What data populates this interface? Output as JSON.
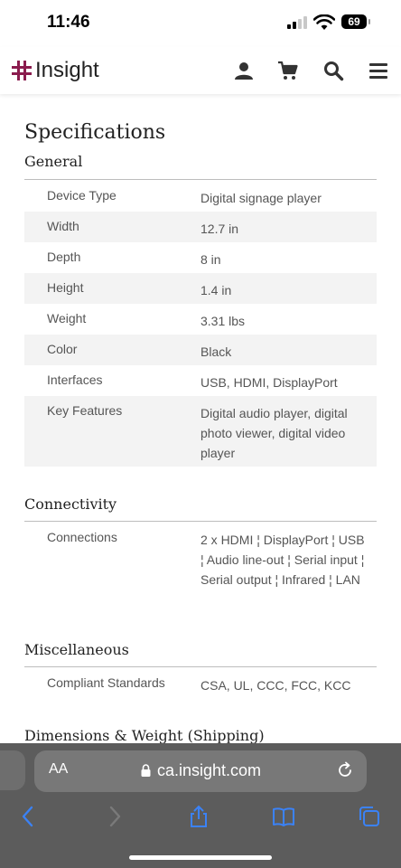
{
  "status_bar": {
    "time": "11:46",
    "battery": "69"
  },
  "header": {
    "logo_text": "Insight"
  },
  "page_title": "Specifications",
  "sections": [
    {
      "title": "General",
      "rows": [
        {
          "label": "Device Type",
          "value": "Digital signage player"
        },
        {
          "label": "Width",
          "value": "12.7 in"
        },
        {
          "label": "Depth",
          "value": "8 in"
        },
        {
          "label": "Height",
          "value": "1.4 in"
        },
        {
          "label": "Weight",
          "value": "3.31 lbs"
        },
        {
          "label": "Color",
          "value": "Black"
        },
        {
          "label": "Interfaces",
          "value": "USB, HDMI, DisplayPort"
        },
        {
          "label": "Key Features",
          "value": "Digital audio player, digital photo viewer, digital video player"
        }
      ]
    },
    {
      "title": "Connectivity",
      "rows": [
        {
          "label": "Connections",
          "value": "2 x HDMI ¦ DisplayPort ¦ USB ¦ Audio line-out ¦ Serial input ¦ Serial output ¦ Infrared ¦ LAN"
        }
      ]
    },
    {
      "title": "Miscellaneous",
      "rows": [
        {
          "label": "Compliant Standards",
          "value": "CSA, UL, CCC, FCC, KCC"
        }
      ]
    },
    {
      "title": "Dimensions & Weight (Shipping)",
      "rows": []
    }
  ],
  "browser": {
    "aa_label": "AA",
    "url": "ca.insight.com"
  }
}
